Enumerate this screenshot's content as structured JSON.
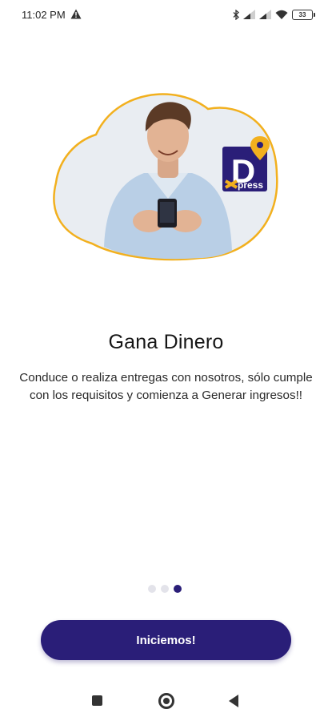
{
  "status_bar": {
    "time": "11:02 PM",
    "battery_level": "33"
  },
  "hero": {
    "logo_letter": "D",
    "logo_text": "press",
    "colors": {
      "outline": "#f2b01e",
      "blob_fill": "#e9edf2",
      "logo_bg": "#2a1e78"
    }
  },
  "onboarding": {
    "title": "Gana Dinero",
    "description": "Conduce o realiza entregas con nosotros, sólo cumple con los requisitos y comienza a Generar ingresos!!",
    "page_indicator": {
      "total": 3,
      "current": 3
    },
    "cta_label": "Iniciemos!"
  },
  "theme": {
    "primary": "#2a1e78",
    "inactive_dot": "#e3e3ea"
  }
}
